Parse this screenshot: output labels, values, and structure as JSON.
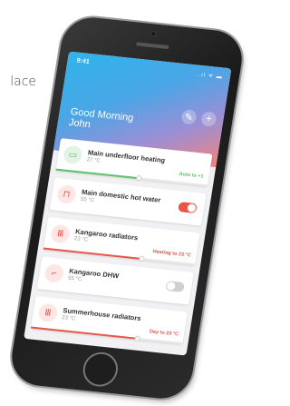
{
  "background_text": "lace",
  "status": {
    "time": "9:41",
    "icons": "..ıl ᯤ ▬"
  },
  "greeting": {
    "line1": "Good Morning",
    "line2": "John"
  },
  "actions": {
    "edit_icon": "pencil-icon",
    "add_icon": "plus-icon",
    "edit_glyph": "✎",
    "add_glyph": "+"
  },
  "colors": {
    "green": "#5cc26a",
    "red": "#e8564a",
    "grey": "#cfcfd4"
  },
  "devices": [
    {
      "title": "Main underfloor heating",
      "temp": "27 °C",
      "status": "Auto to +1",
      "icon": "underfloor-heating-icon",
      "glyph": "▭",
      "state": "auto",
      "level": 0.55
    },
    {
      "title": "Main domestic hot water",
      "temp": "55 °C",
      "status": "",
      "icon": "tap-icon",
      "glyph": "⊓",
      "state": "on",
      "toggle": true
    },
    {
      "title": "Kangaroo radiators",
      "temp": "23 °C",
      "status": "Heating to 23 °C",
      "icon": "radiator-icon",
      "glyph": "Ⅲ",
      "state": "heating",
      "level": 0.65
    },
    {
      "title": "Kangaroo DHW",
      "temp": "55 °C",
      "status": "",
      "icon": "tap-icon",
      "glyph": "⌐",
      "state": "off",
      "toggle": false
    },
    {
      "title": "Summerhouse radiators",
      "temp": "23 °C",
      "status": "Day to 23 °C",
      "icon": "radiator-icon",
      "glyph": "Ⅲ",
      "state": "heating",
      "level": 0.7
    }
  ]
}
